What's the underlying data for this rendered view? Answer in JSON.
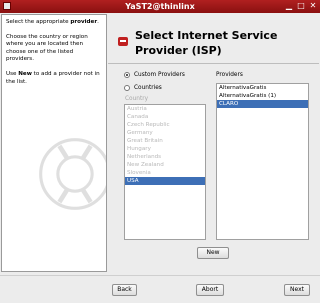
{
  "window": {
    "title": "YaST2@thinlinx"
  },
  "help": {
    "p1_pre": "Select the appropriate ",
    "p1_bold": "provider",
    "p1_post": ".",
    "p2": "Choose the country or region where you are located then choose one of the listed providers.",
    "p3_pre": "Use ",
    "p3_bold": "New",
    "p3_post": " to add a provider not in the list."
  },
  "main": {
    "title": "Select Internet Service Provider (ISP)"
  },
  "options": {
    "custom_label": "Custom Providers",
    "countries_label": "Countries",
    "country_header": "Country",
    "selected": "custom"
  },
  "countries": [
    "Austria",
    "Canada",
    "Czech Republic",
    "Germany",
    "Great Britain",
    "Hungary",
    "Netherlands",
    "New Zealand",
    "Slovenia",
    "USA"
  ],
  "selected_country": "USA",
  "providers_header": "Providers",
  "providers": [
    "AlternativaGratis",
    "AlternativaGratis (1)",
    "CLARO"
  ],
  "selected_provider": "CLARO",
  "buttons": {
    "new": "New",
    "back": "Back",
    "abort": "Abort",
    "next": "Next"
  },
  "colors": {
    "titlebar": "#9c1818",
    "selection": "#3d6fb6",
    "accent": "#c02020"
  }
}
